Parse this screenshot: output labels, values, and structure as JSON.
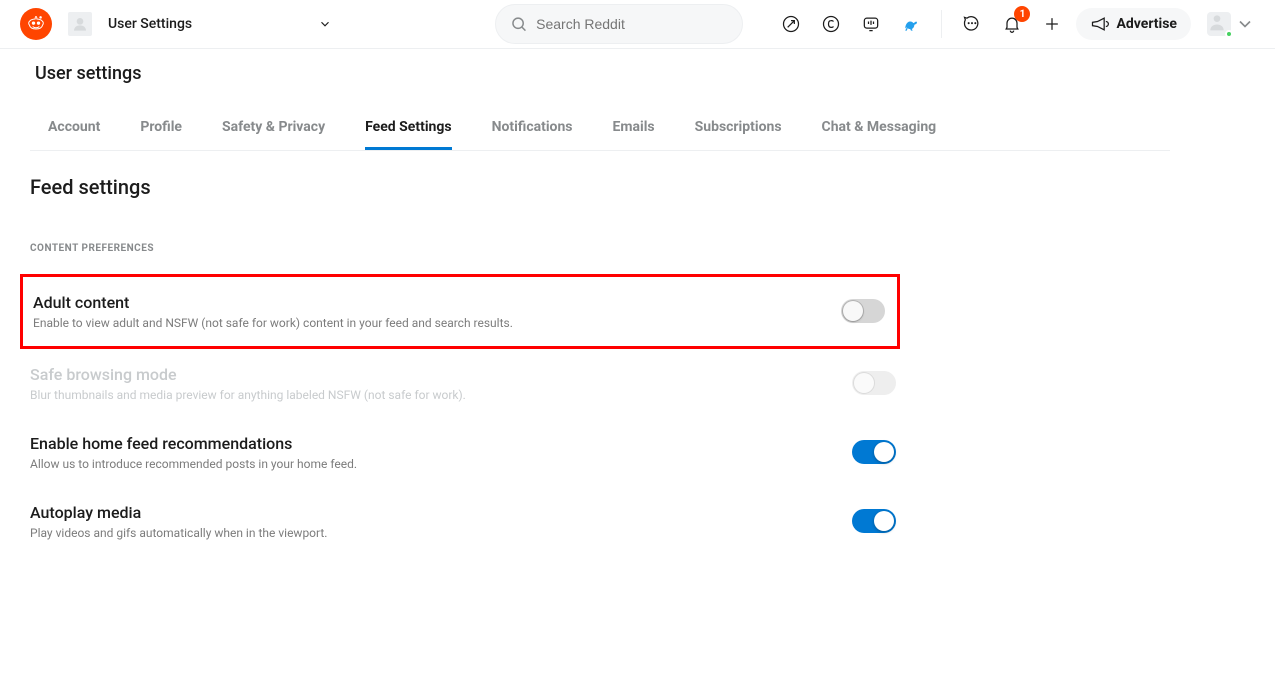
{
  "header": {
    "nav_label": "User Settings",
    "search_placeholder": "Search Reddit",
    "notification_count": "1",
    "advertise_label": "Advertise"
  },
  "page": {
    "title": "User settings",
    "tabs": [
      {
        "label": "Account",
        "active": false
      },
      {
        "label": "Profile",
        "active": false
      },
      {
        "label": "Safety & Privacy",
        "active": false
      },
      {
        "label": "Feed Settings",
        "active": true
      },
      {
        "label": "Notifications",
        "active": false
      },
      {
        "label": "Emails",
        "active": false
      },
      {
        "label": "Subscriptions",
        "active": false
      },
      {
        "label": "Chat & Messaging",
        "active": false
      }
    ],
    "section_title": "Feed settings",
    "section_label": "CONTENT PREFERENCES",
    "settings": [
      {
        "title": "Adult content",
        "desc": "Enable to view adult and NSFW (not safe for work) content in your feed and search results.",
        "on": false,
        "disabled": false,
        "highlight": true
      },
      {
        "title": "Safe browsing mode",
        "desc": "Blur thumbnails and media preview for anything labeled NSFW (not safe for work).",
        "on": false,
        "disabled": true,
        "highlight": false
      },
      {
        "title": "Enable home feed recommendations",
        "desc": "Allow us to introduce recommended posts in your home feed.",
        "on": true,
        "disabled": false,
        "highlight": false
      },
      {
        "title": "Autoplay media",
        "desc": "Play videos and gifs automatically when in the viewport.",
        "on": true,
        "disabled": false,
        "highlight": false
      }
    ]
  }
}
